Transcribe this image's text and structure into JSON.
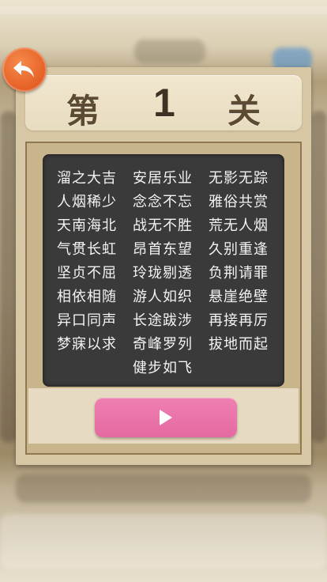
{
  "level": {
    "prefix": "第",
    "number": "1",
    "suffix": "关"
  },
  "idioms": {
    "column1": [
      "溜之大吉",
      "人烟稀少",
      "天南海北",
      "气贯长虹",
      "坚贞不屈",
      "相依相随",
      "异口同声",
      "梦寐以求"
    ],
    "column2": [
      "安居乐业",
      "念念不忘",
      "战无不胜",
      "昂首东望",
      "玲珑剔透",
      "游人如织",
      "长途跋涉",
      "奇峰罗列",
      "健步如飞"
    ],
    "column3": [
      "无影无踪",
      "雅俗共赏",
      "荒无人烟",
      "久别重逢",
      "负荆请罪",
      "悬崖绝壁",
      "再接再厉",
      "拔地而起"
    ]
  },
  "icons": {
    "back": "back-arrow-icon",
    "play": "play-icon"
  },
  "colors": {
    "back_button": "#e8652a",
    "play_button": "#e56aa2",
    "blackboard": "#3a3a3a"
  }
}
